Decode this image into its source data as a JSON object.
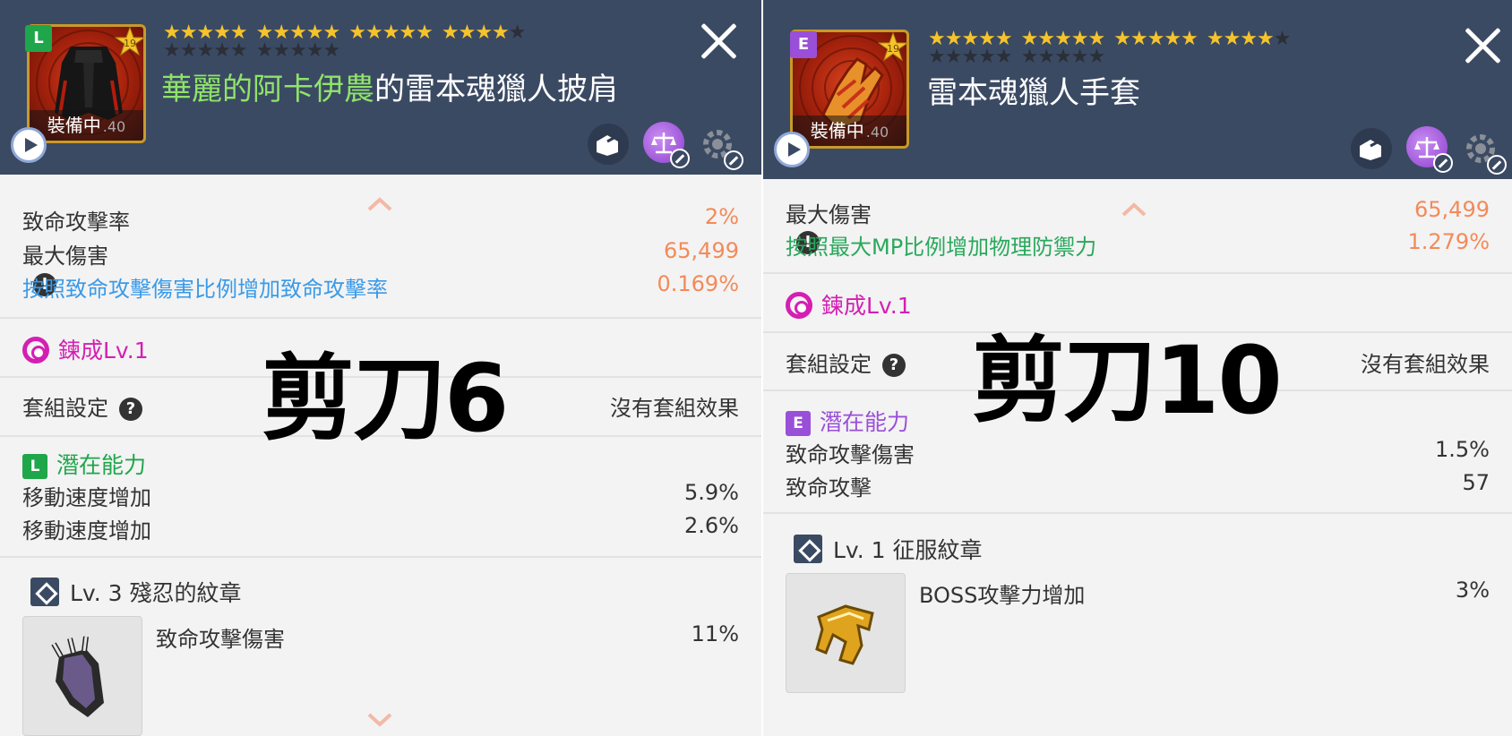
{
  "left": {
    "grade": "L",
    "star_level": "19",
    "equipped_label": "裝備中",
    "equipped_suffix": ".40",
    "title_highlight": "華麗的阿卡伊農",
    "title_rest": "的雷本魂獵人披肩",
    "stars_filled": 21,
    "stats": [
      {
        "label": "致命攻擊率",
        "value": "2%"
      },
      {
        "label": "最大傷害",
        "value": "65,499"
      },
      {
        "label": "按照致命攻擊傷害比例增加致命攻擊率",
        "value": "0.169%"
      }
    ],
    "refine_label": "鍊成Lv.1",
    "set_label": "套組設定",
    "set_value": "沒有套組效果",
    "potential_grade": "L",
    "potential_label": "潛在能力",
    "potential": [
      {
        "label": "移動速度增加",
        "value": "5.9%"
      },
      {
        "label": "移動速度增加",
        "value": "2.6%"
      }
    ],
    "emblem_title": "Lv. 3 殘忍的紋章",
    "emblem_stat_label": "致命攻擊傷害",
    "emblem_stat_value": "11%",
    "overlay": "剪刀6"
  },
  "right": {
    "grade": "E",
    "star_level": "19",
    "equipped_label": "裝備中",
    "equipped_suffix": ".40",
    "title": "雷本魂獵人手套",
    "stars_filled": 21,
    "stats": [
      {
        "label": "最大傷害",
        "value": "65,499"
      },
      {
        "label": "按照最大MP比例增加物理防禦力",
        "value": "1.279%"
      }
    ],
    "refine_label": "鍊成Lv.1",
    "set_label": "套組設定",
    "set_value": "沒有套組效果",
    "potential_grade": "E",
    "potential_label": "潛在能力",
    "potential": [
      {
        "label": "致命攻擊傷害",
        "value": "1.5%"
      },
      {
        "label": "致命攻擊",
        "value": "57"
      }
    ],
    "emblem_title": "Lv. 1 征服紋章",
    "emblem_stat_label": "BOSS攻擊力增加",
    "emblem_stat_value": "3%",
    "overlay": "剪刀10"
  },
  "info_mark": "!",
  "help_mark": "?",
  "colors": {
    "header_bg": "#3b4a63",
    "accent_orange": "#f38a5a",
    "accent_green": "#8fe36a",
    "refine_magenta": "#d41fb3",
    "grade_L": "#1fa64a",
    "grade_E": "#9a4fd8",
    "blue_stat": "#3a9ae8"
  }
}
